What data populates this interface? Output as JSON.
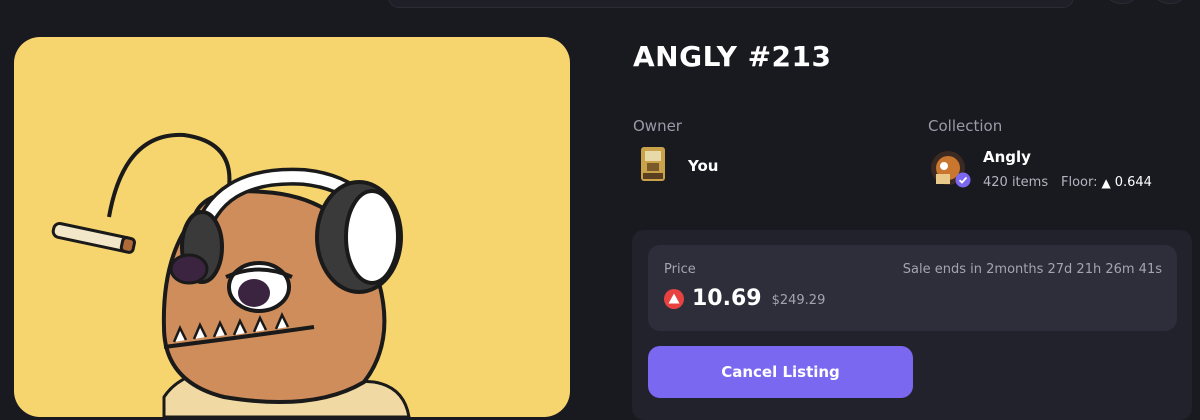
{
  "nft": {
    "title": "ANGLY #213"
  },
  "owner": {
    "label": "Owner",
    "name": "You"
  },
  "collection": {
    "label": "Collection",
    "name": "Angly",
    "items": "420 items",
    "floor_label": "Floor:",
    "floor_value": "0.644",
    "verified_icon": "verified-badge-icon"
  },
  "listing": {
    "price_label": "Price",
    "sale_ends": "Sale ends in 2months 27d 21h 26m 41s",
    "price": "10.69",
    "price_usd": "$249.29",
    "currency_icon": "avax-icon",
    "cancel_label": "Cancel Listing"
  },
  "colors": {
    "background": "#191920",
    "artwork_bg": "#f6d56e",
    "accent_button": "#7b68f0",
    "avax_red": "#e84142"
  }
}
